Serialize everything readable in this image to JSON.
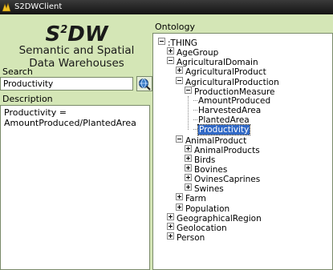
{
  "window": {
    "title": "S2DWClient"
  },
  "logo": {
    "main": "S",
    "sup": "2",
    "rest": "DW"
  },
  "subtitle": {
    "line1": "Semantic and Spatial",
    "line2": "Data Warehouses"
  },
  "search": {
    "label": "Search",
    "value": "Productivity"
  },
  "description": {
    "label": "Description",
    "text": "Productivity =\nAmountProduced/PlantedArea"
  },
  "ontology": {
    "label": "Ontology",
    "nodes": [
      {
        "label": ":THING",
        "expander": "minus"
      },
      {
        "label": "AgeGroup",
        "expander": "plus"
      },
      {
        "label": "AgriculturalDomain",
        "expander": "minus"
      },
      {
        "label": "AgriculturalProduct",
        "expander": "plus"
      },
      {
        "label": "AgriculturalProduction",
        "expander": "minus"
      },
      {
        "label": "ProductionMeasure",
        "expander": "minus"
      },
      {
        "label": "AmountProduced",
        "expander": "leaf"
      },
      {
        "label": "HarvestedArea",
        "expander": "leaf"
      },
      {
        "label": "PlantedArea",
        "expander": "leaf"
      },
      {
        "label": "Productivity",
        "expander": "leaf",
        "selected": true
      },
      {
        "label": "AnimalProduct",
        "expander": "minus"
      },
      {
        "label": "AnimalProducts",
        "expander": "plus"
      },
      {
        "label": "Birds",
        "expander": "plus"
      },
      {
        "label": "Bovines",
        "expander": "plus"
      },
      {
        "label": "OvinesCaprines",
        "expander": "plus"
      },
      {
        "label": "Swines",
        "expander": "plus"
      },
      {
        "label": "Farm",
        "expander": "plus"
      },
      {
        "label": "Population",
        "expander": "plus"
      },
      {
        "label": "GeographicalRegion",
        "expander": "plus"
      },
      {
        "label": "Geolocation",
        "expander": "plus"
      },
      {
        "label": "Person",
        "expander": "plus"
      }
    ]
  },
  "colors": {
    "background": "#d4e6b6",
    "selection": "#3169c6"
  }
}
